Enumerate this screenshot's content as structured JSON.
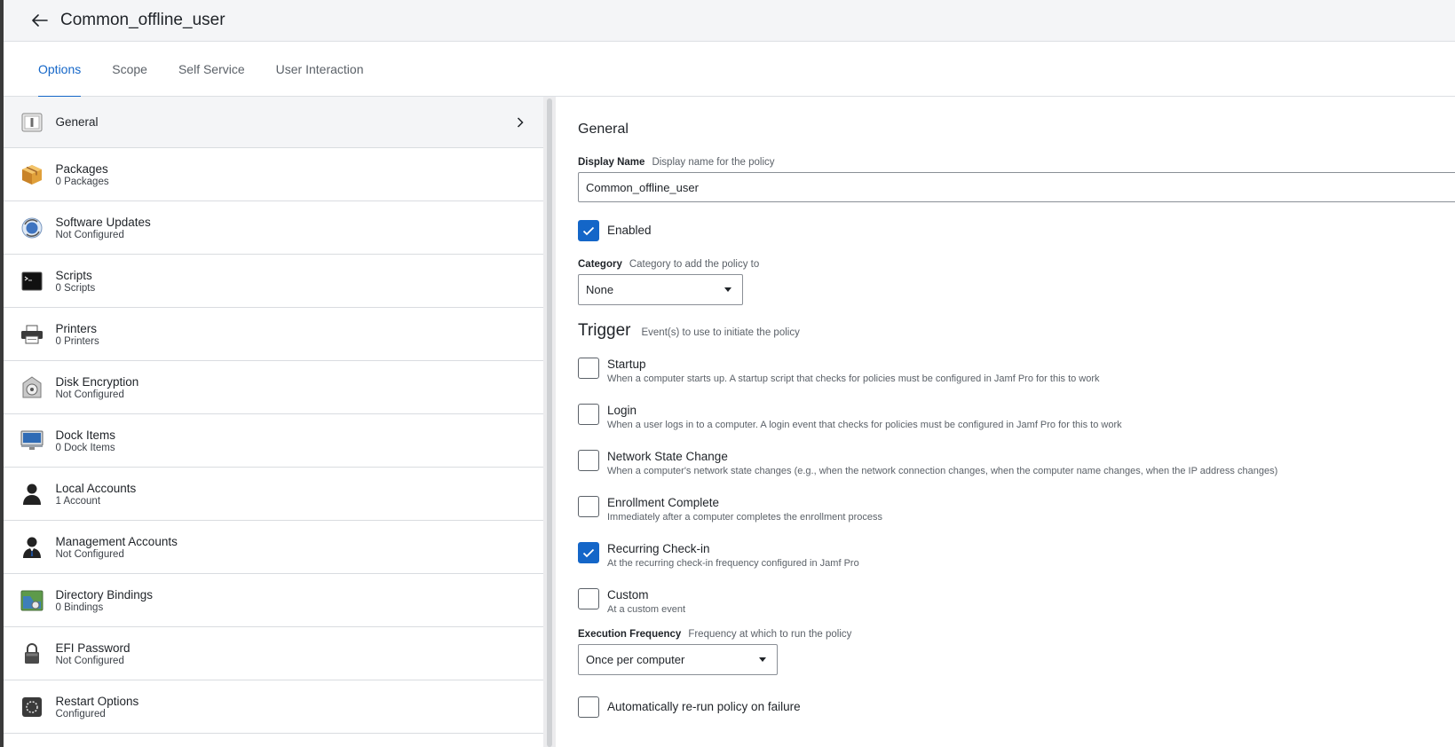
{
  "header": {
    "title": "Common_offline_user"
  },
  "tabs": [
    {
      "label": "Options",
      "active": true
    },
    {
      "label": "Scope"
    },
    {
      "label": "Self Service"
    },
    {
      "label": "User Interaction"
    }
  ],
  "sidebar": {
    "items": [
      {
        "label": "General",
        "sub": "",
        "icon": "general-icon",
        "active": true
      },
      {
        "label": "Packages",
        "sub": "0 Packages",
        "icon": "package-icon"
      },
      {
        "label": "Software Updates",
        "sub": "Not Configured",
        "icon": "software-update-icon"
      },
      {
        "label": "Scripts",
        "sub": "0 Scripts",
        "icon": "terminal-icon"
      },
      {
        "label": "Printers",
        "sub": "0 Printers",
        "icon": "printer-icon"
      },
      {
        "label": "Disk Encryption",
        "sub": "Not Configured",
        "icon": "disk-encryption-icon"
      },
      {
        "label": "Dock Items",
        "sub": "0 Dock Items",
        "icon": "monitor-icon"
      },
      {
        "label": "Local Accounts",
        "sub": "1 Account",
        "icon": "user-icon"
      },
      {
        "label": "Management Accounts",
        "sub": "Not Configured",
        "icon": "manager-icon"
      },
      {
        "label": "Directory Bindings",
        "sub": "0 Bindings",
        "icon": "directory-icon"
      },
      {
        "label": "EFI Password",
        "sub": "Not Configured",
        "icon": "lock-icon"
      },
      {
        "label": "Restart Options",
        "sub": "Configured",
        "icon": "restart-icon"
      }
    ]
  },
  "general": {
    "section_title": "General",
    "display_name": {
      "label": "Display Name",
      "hint": "Display name for the policy",
      "value": "Common_offline_user"
    },
    "enabled": {
      "label": "Enabled",
      "checked": true
    },
    "category": {
      "label": "Category",
      "hint": "Category to add the policy to",
      "value": "None"
    },
    "trigger": {
      "title": "Trigger",
      "hint": "Event(s) to use to initiate the policy",
      "options": [
        {
          "label": "Startup",
          "desc": "When a computer starts up. A startup script that checks for policies must be configured in Jamf Pro for this to work",
          "checked": false
        },
        {
          "label": "Login",
          "desc": "When a user logs in to a computer. A login event that checks for policies must be configured in Jamf Pro for this to work",
          "checked": false
        },
        {
          "label": "Network State Change",
          "desc": "When a computer's network state changes (e.g., when the network connection changes, when the computer name changes, when the IP address changes)",
          "checked": false
        },
        {
          "label": "Enrollment Complete",
          "desc": "Immediately after a computer completes the enrollment process",
          "checked": false
        },
        {
          "label": "Recurring Check-in",
          "desc": "At the recurring check-in frequency configured in Jamf Pro",
          "checked": true
        },
        {
          "label": "Custom",
          "desc": "At a custom event",
          "checked": false
        }
      ]
    },
    "execution_frequency": {
      "label": "Execution Frequency",
      "hint": "Frequency at which to run the policy",
      "value": "Once per computer"
    },
    "rerun": {
      "label": "Automatically re-run policy on failure",
      "checked": false
    }
  },
  "colors": {
    "accent": "#1466c8",
    "header_bg": "#f4f5f7",
    "border": "#d9dce0"
  }
}
